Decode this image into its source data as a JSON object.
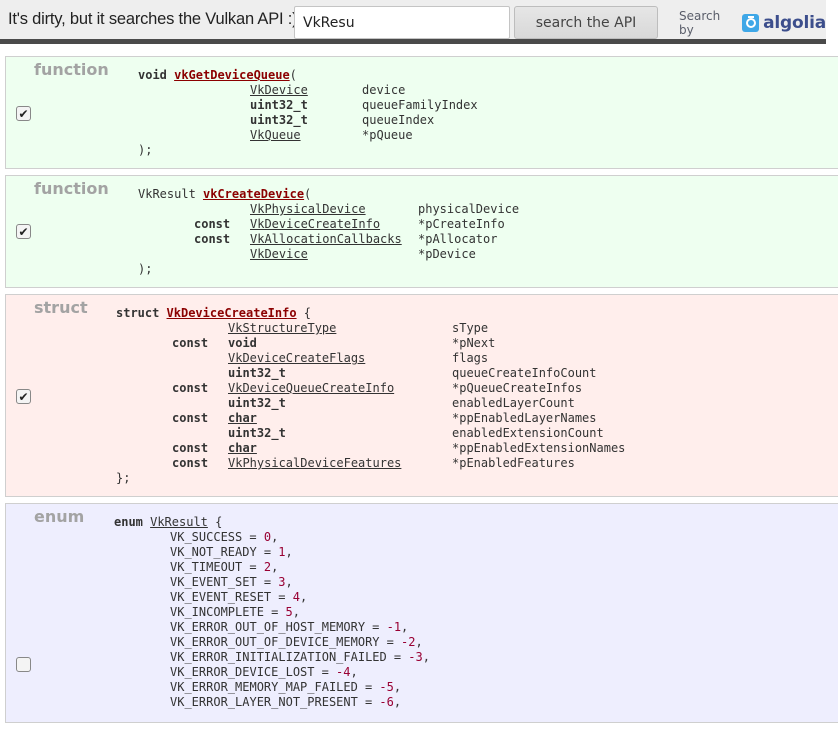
{
  "header": {
    "tagline": "It's dirty, but it searches the Vulkan API :)",
    "search_value": "VkResu",
    "search_button": "search the API",
    "search_by": "Search by",
    "brand": "algolia"
  },
  "results": [
    {
      "kind": "function",
      "checked": true,
      "return_type": "void",
      "name": "vkGetDeviceQueue",
      "params": [
        {
          "qualifier": "",
          "type": "VkDevice",
          "type_style": "link",
          "name": "device"
        },
        {
          "qualifier": "",
          "type": "uint32_t",
          "type_style": "bold",
          "name": "queueFamilyIndex"
        },
        {
          "qualifier": "",
          "type": "uint32_t",
          "type_style": "bold",
          "name": "queueIndex"
        },
        {
          "qualifier": "",
          "type": "VkQueue",
          "type_style": "link",
          "name": "*pQueue"
        }
      ],
      "close": ");"
    },
    {
      "kind": "function",
      "checked": true,
      "return_type": "VkResult",
      "name": "vkCreateDevice",
      "params": [
        {
          "qualifier": "",
          "type": "VkPhysicalDevice",
          "type_style": "link",
          "name": "physicalDevice"
        },
        {
          "qualifier": "const",
          "type": "VkDeviceCreateInfo",
          "type_style": "link",
          "name": "*pCreateInfo"
        },
        {
          "qualifier": "const",
          "type": "VkAllocationCallbacks",
          "type_style": "link",
          "name": "*pAllocator"
        },
        {
          "qualifier": "",
          "type": "VkDevice",
          "type_style": "link",
          "name": "*pDevice"
        }
      ],
      "close": ");"
    },
    {
      "kind": "struct",
      "checked": true,
      "keyword": "struct",
      "name": "VkDeviceCreateInfo",
      "members": [
        {
          "qualifier": "",
          "type": "VkStructureType",
          "type_style": "link",
          "name": "sType"
        },
        {
          "qualifier": "const",
          "type": "void",
          "type_style": "bold",
          "name": "*pNext"
        },
        {
          "qualifier": "",
          "type": "VkDeviceCreateFlags",
          "type_style": "link",
          "name": "flags"
        },
        {
          "qualifier": "",
          "type": "uint32_t",
          "type_style": "bold",
          "name": "queueCreateInfoCount"
        },
        {
          "qualifier": "const",
          "type": "VkDeviceQueueCreateInfo",
          "type_style": "link",
          "name": "*pQueueCreateInfos"
        },
        {
          "qualifier": "",
          "type": "uint32_t",
          "type_style": "bold",
          "name": "enabledLayerCount"
        },
        {
          "qualifier": "const",
          "type": "char",
          "type_style": "boldlink",
          "name": "*ppEnabledLayerNames"
        },
        {
          "qualifier": "",
          "type": "uint32_t",
          "type_style": "bold",
          "name": "enabledExtensionCount"
        },
        {
          "qualifier": "const",
          "type": "char",
          "type_style": "boldlink",
          "name": "*ppEnabledExtensionNames"
        },
        {
          "qualifier": "const",
          "type": "VkPhysicalDeviceFeatures",
          "type_style": "link",
          "name": "*pEnabledFeatures"
        }
      ],
      "close": "};"
    },
    {
      "kind": "enum",
      "checked": false,
      "keyword": "enum",
      "name": "VkResult",
      "values": [
        {
          "name": "VK_SUCCESS",
          "value": "0"
        },
        {
          "name": "VK_NOT_READY",
          "value": "1"
        },
        {
          "name": "VK_TIMEOUT",
          "value": "2"
        },
        {
          "name": "VK_EVENT_SET",
          "value": "3"
        },
        {
          "name": "VK_EVENT_RESET",
          "value": "4"
        },
        {
          "name": "VK_INCOMPLETE",
          "value": "5"
        },
        {
          "name": "VK_ERROR_OUT_OF_HOST_MEMORY",
          "value": "-1"
        },
        {
          "name": "VK_ERROR_OUT_OF_DEVICE_MEMORY",
          "value": "-2"
        },
        {
          "name": "VK_ERROR_INITIALIZATION_FAILED",
          "value": "-3"
        },
        {
          "name": "VK_ERROR_DEVICE_LOST",
          "value": "-4"
        },
        {
          "name": "VK_ERROR_MEMORY_MAP_FAILED",
          "value": "-5"
        },
        {
          "name": "VK_ERROR_LAYER_NOT_PRESENT",
          "value": "-6"
        }
      ]
    }
  ],
  "icons": {
    "checked": "✔",
    "algolia_logo": "stopwatch-icon"
  },
  "colors": {
    "function_bg": "#eefff0",
    "struct_bg": "#ffeeec",
    "enum_bg": "#eeeefe",
    "name_color": "#8b0000",
    "number_color": "#990033",
    "header_bar": "#4a4a4a",
    "algolia_blue": "#3ea7e7",
    "algolia_brand": "#3c4e8c"
  }
}
